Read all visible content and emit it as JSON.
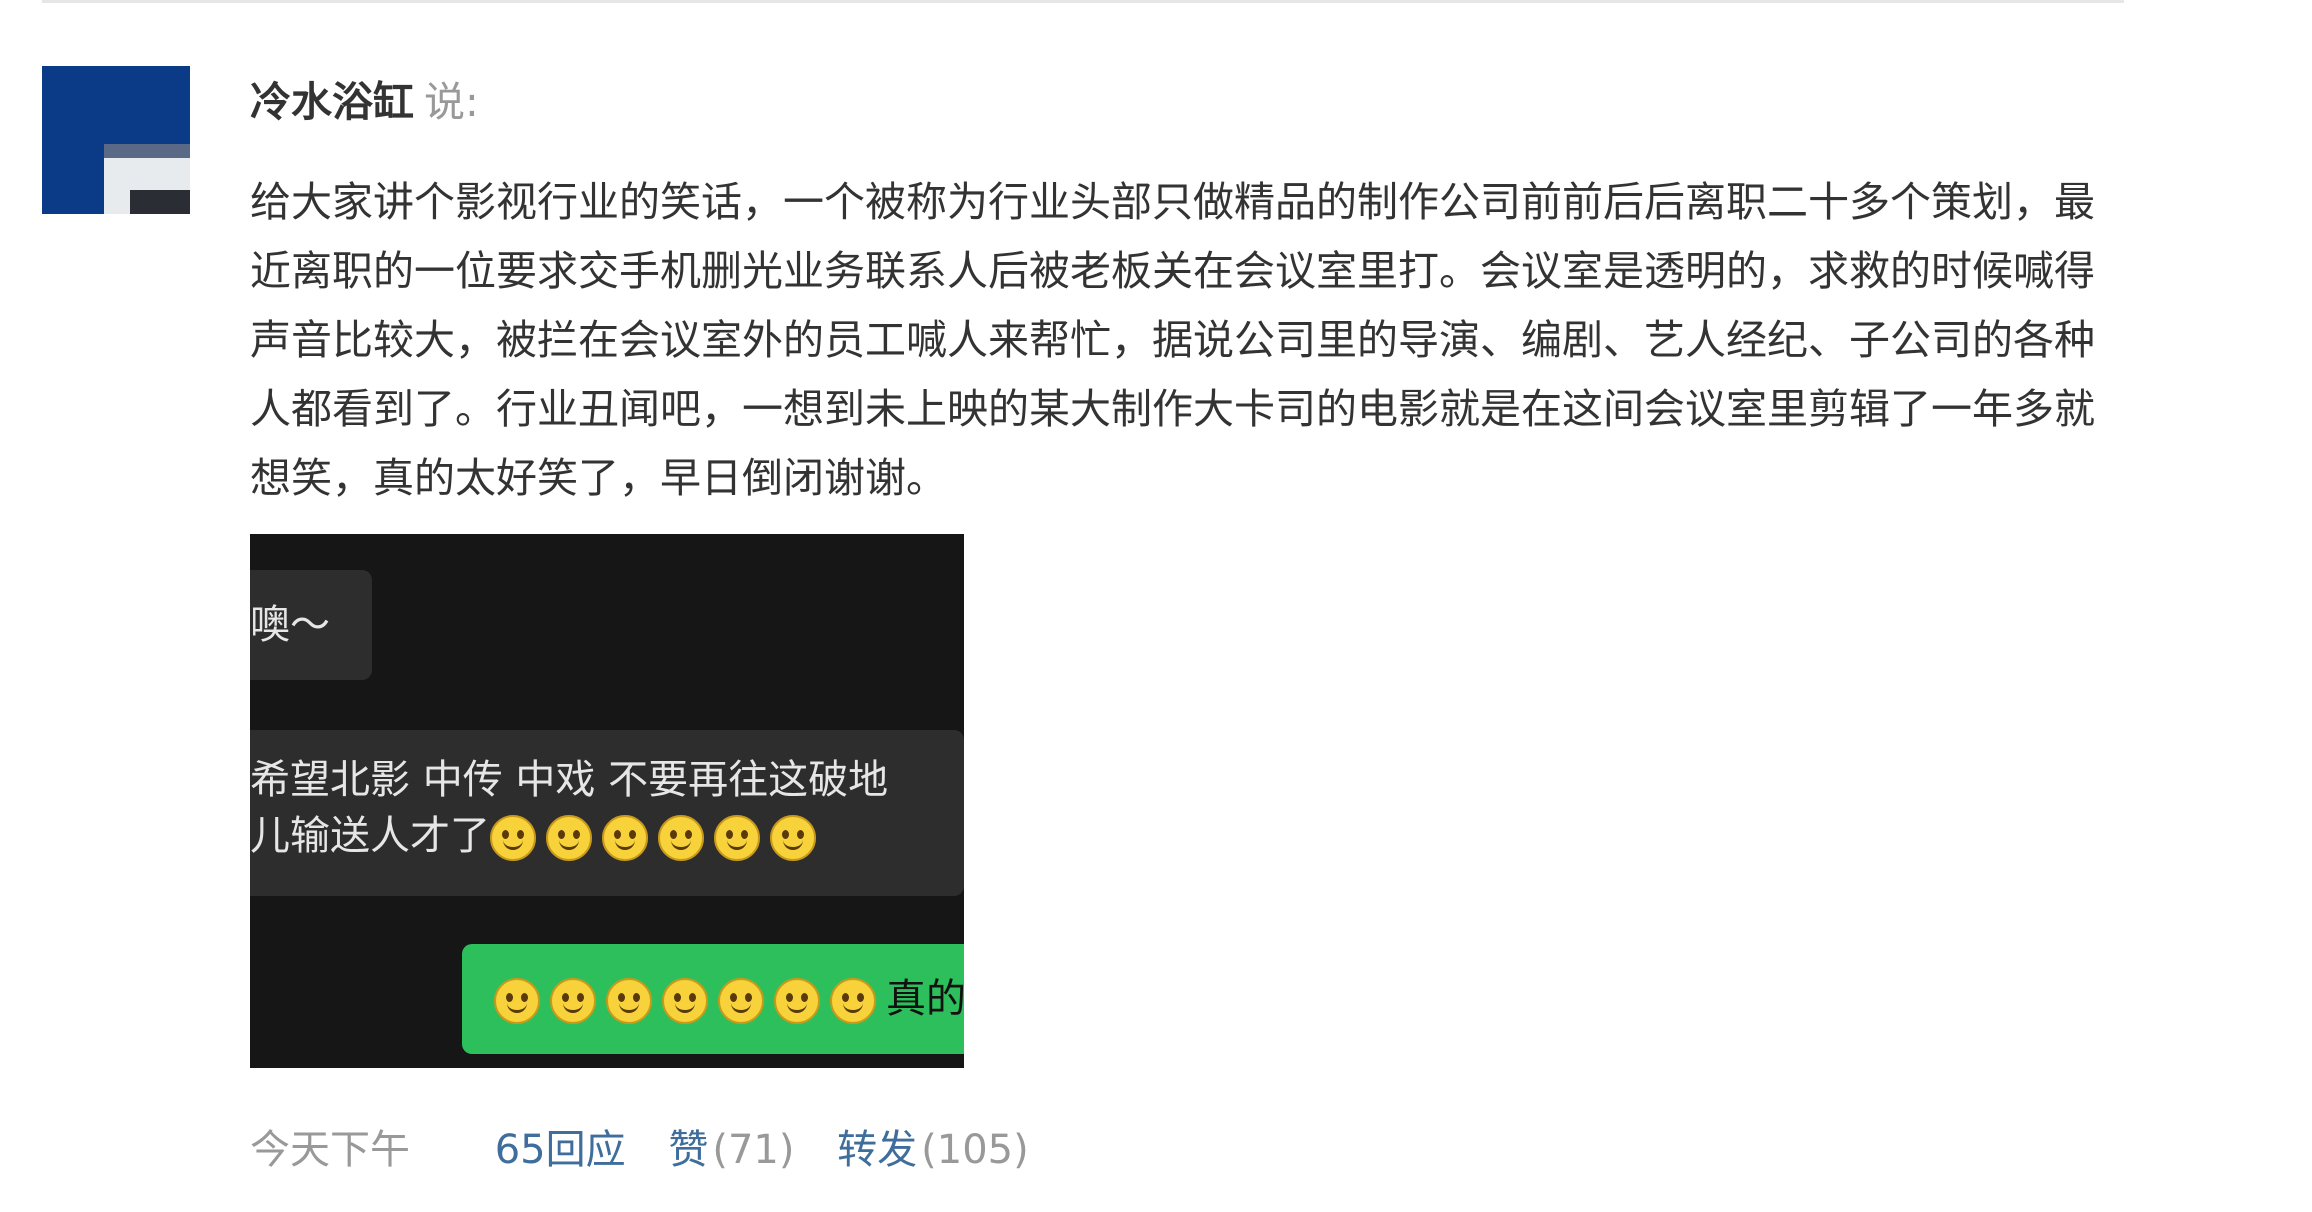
{
  "post": {
    "author_name": "冷水浴缸",
    "says_label": "说:",
    "body_text": "给大家讲个影视行业的笑话，一个被称为行业头部只做精品的制作公司前前后后离职二十多个策划，最近离职的一位要求交手机删光业务联系人后被老板关在会议室里打。会议室是透明的，求救的时候喊得声音比较大，被拦在会议室外的员工喊人来帮忙，据说公司里的导演、编剧、艺人经纪、子公司的各种人都看到了。行业丑闻吧，一想到未上映的某大制作大卡司的电影就是在这间会议室里剪辑了一年多就想笑，真的太好笑了，早日倒闭谢谢。"
  },
  "image": {
    "messages": [
      {
        "text": "噢～"
      },
      {
        "line_1": "希望北影 中传 中戏 不要再往这破地",
        "line_2": "儿输送人才了",
        "emoji_count": 6
      },
      {
        "emoji_count": 7,
        "text": "真的"
      }
    ],
    "emoji_name": "smile-emoji-icon"
  },
  "footer": {
    "time": "今天下午",
    "replies_label": "65回应",
    "like_label": "赞",
    "like_count": "(71)",
    "repost_label": "转发",
    "repost_count": "(105)"
  },
  "colors": {
    "link": "#3f6e9c",
    "muted": "#999999",
    "text": "#333333",
    "green_bubble": "#2dbf5b",
    "dark_bubble": "#2d2d2d"
  }
}
